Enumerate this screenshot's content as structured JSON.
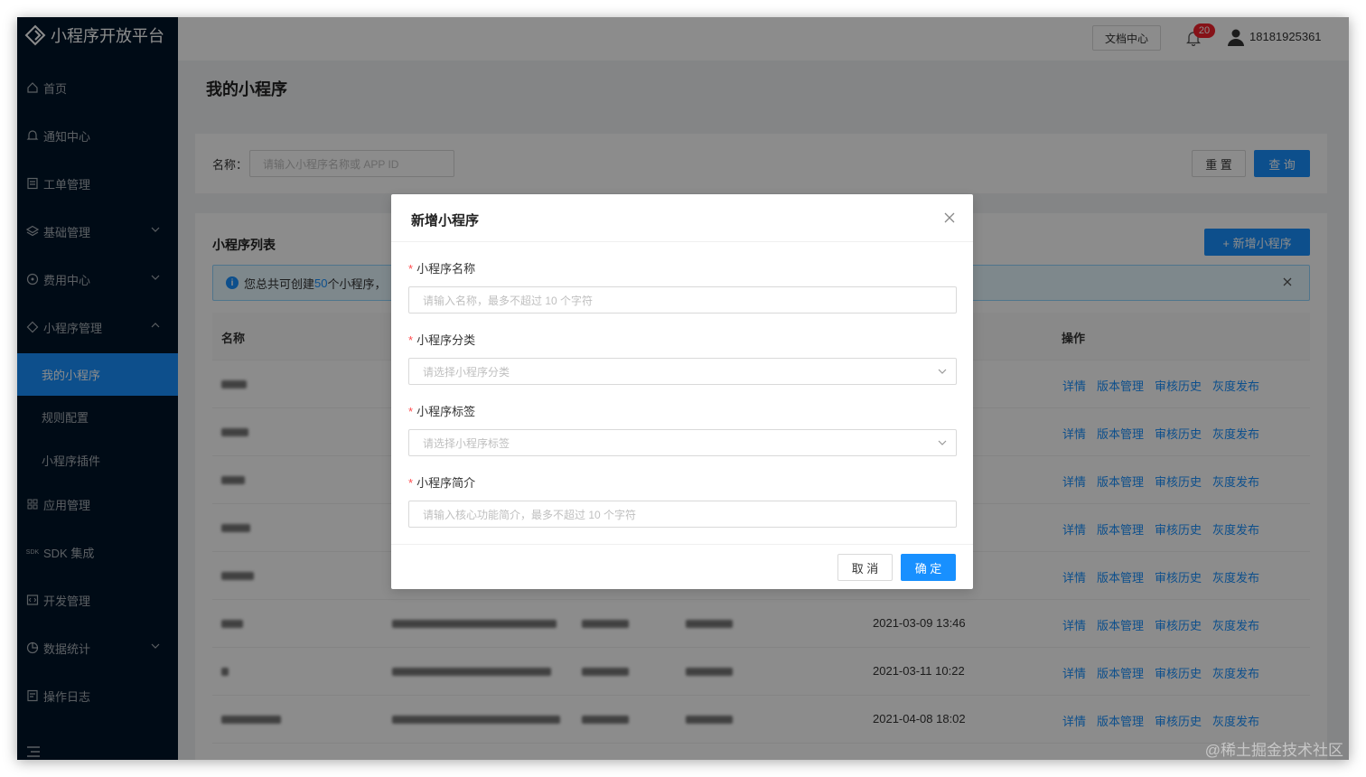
{
  "brand": {
    "title": "小程序开放平台"
  },
  "sidebar": {
    "items": [
      {
        "label": "首页",
        "icon": "home-icon"
      },
      {
        "label": "通知中心",
        "icon": "bell-icon"
      },
      {
        "label": "工单管理",
        "icon": "ticket-icon"
      },
      {
        "label": "基础管理",
        "icon": "layers-icon",
        "expandable": true
      },
      {
        "label": "费用中心",
        "icon": "coin-icon",
        "expandable": true
      },
      {
        "label": "小程序管理",
        "icon": "diamond-icon",
        "expanded": true
      },
      {
        "label": "我的小程序",
        "sub": true,
        "active": true
      },
      {
        "label": "规则配置",
        "sub": true
      },
      {
        "label": "小程序插件",
        "sub": true
      },
      {
        "label": "应用管理",
        "icon": "grid-icon"
      },
      {
        "label": "SDK 集成",
        "icon": "sdk-icon",
        "icon_text": "SDK"
      },
      {
        "label": "开发管理",
        "icon": "code-icon"
      },
      {
        "label": "数据统计",
        "icon": "pie-icon",
        "expandable": true
      },
      {
        "label": "操作日志",
        "icon": "log-icon"
      }
    ]
  },
  "header": {
    "doc_button": "文档中心",
    "notification_count": "20",
    "user_name": "18181925361"
  },
  "page": {
    "title": "我的小程序"
  },
  "search": {
    "label": "名称：",
    "placeholder": "请输入小程序名称或 APP ID",
    "reset": "重 置",
    "query": "查 询"
  },
  "list": {
    "title": "小程序列表",
    "add_button": "+ 新增小程序",
    "alert_prefix": "您总共可创建",
    "alert_count": "50",
    "alert_suffix": "个小程序，",
    "col_name": "名称",
    "col_ops": "操作",
    "ops": [
      "详情",
      "版本管理",
      "审核历史",
      "灰度发布"
    ],
    "rows": [
      {
        "time": ""
      },
      {
        "time": ""
      },
      {
        "time": ""
      },
      {
        "time": ""
      },
      {
        "time": ""
      },
      {
        "time": "2021-03-09 13:46"
      },
      {
        "time": "2021-03-11 10:22"
      },
      {
        "time": "2021-04-08 18:02"
      }
    ]
  },
  "modal": {
    "title": "新增小程序",
    "fields": [
      {
        "label": "小程序名称",
        "placeholder": "请输入名称，最多不超过 10 个字符",
        "type": "input"
      },
      {
        "label": "小程序分类",
        "placeholder": "请选择小程序分类",
        "type": "select"
      },
      {
        "label": "小程序标签",
        "placeholder": "请选择小程序标签",
        "type": "select"
      },
      {
        "label": "小程序简介",
        "placeholder": "请输入核心功能简介，最多不超过 10 个字符",
        "type": "input"
      }
    ],
    "cancel": "取 消",
    "ok": "确 定"
  },
  "watermark": "@稀土掘金技术社区",
  "colors": {
    "primary": "#1890ff",
    "sidebar": "#001529",
    "danger": "#ff4d4f"
  }
}
